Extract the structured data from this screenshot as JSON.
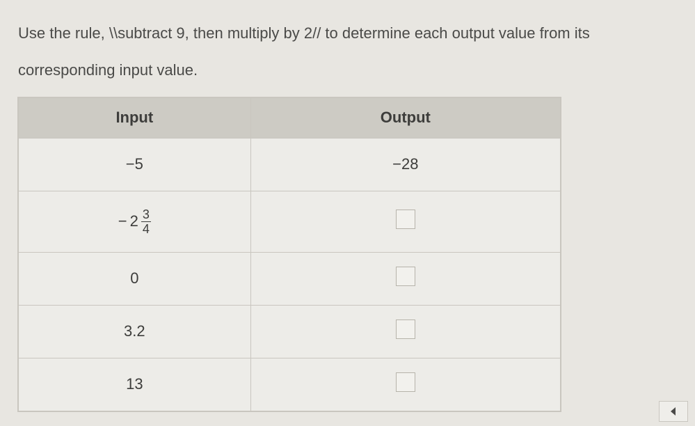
{
  "prompt": {
    "line1": "Use the rule, \\\\subtract 9, then multiply by 2// to determine each output value from its",
    "line2": "corresponding input value."
  },
  "table": {
    "headers": {
      "input": "Input",
      "output": "Output"
    },
    "rows": [
      {
        "input_plain": "−5",
        "output_plain": "−28",
        "has_box": false,
        "is_fraction": false
      },
      {
        "input_fraction": {
          "sign": "−",
          "whole": "2",
          "num": "3",
          "den": "4"
        },
        "output_plain": "",
        "has_box": true,
        "is_fraction": true
      },
      {
        "input_plain": "0",
        "output_plain": "",
        "has_box": true,
        "is_fraction": false
      },
      {
        "input_plain": "3.2",
        "output_plain": "",
        "has_box": true,
        "is_fraction": false
      },
      {
        "input_plain": "13",
        "output_plain": "",
        "has_box": true,
        "is_fraction": false
      }
    ]
  },
  "icons": {
    "nav_arrow": "previous-arrow"
  }
}
